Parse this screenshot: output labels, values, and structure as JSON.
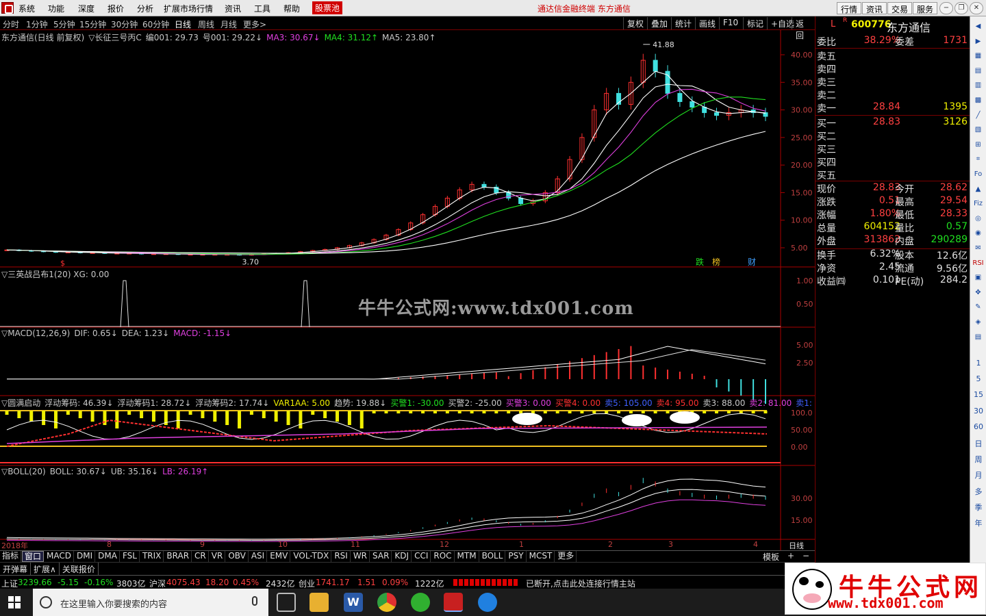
{
  "menu": {
    "items": [
      "系统",
      "功能",
      "深度",
      "报价",
      "分析",
      "扩展市场行情",
      "资讯",
      "工具",
      "帮助"
    ],
    "pool": "股票池",
    "center_title": "通达信金融终端  东方通信",
    "right_buttons": [
      "行情",
      "资讯",
      "交易",
      "服务"
    ]
  },
  "periods": [
    "分时",
    "1分钟",
    "5分钟",
    "15分钟",
    "30分钟",
    "60分钟",
    "日线",
    "周线",
    "月线",
    "更多>"
  ],
  "active_period": "日线",
  "toolbar": [
    "复权",
    "叠加",
    "统计",
    "画线",
    "F10",
    "标记",
    "+自选",
    "返回"
  ],
  "main_panel": {
    "title": "东方通信(日线 前复权)",
    "indicator": "▽长征三号丙C",
    "items": [
      {
        "text": "编001: 29.73",
        "color": "#c8c8c8"
      },
      {
        "text": "号001: 29.22↓",
        "color": "#c8c8c8"
      },
      {
        "text": "MA3: 30.67↓",
        "color": "#e040e0"
      },
      {
        "text": "MA4: 31.12↑",
        "color": "#20e020"
      },
      {
        "text": "MA5: 23.80↑",
        "color": "#c8c8c8"
      }
    ],
    "high_label": "41.88",
    "low_label": "3.70",
    "markers": [
      "跌",
      "榜",
      "财"
    ]
  },
  "panel2": {
    "title": "▽三英战吕布1(20)  XG: 0.00",
    "axis": [
      "1.00",
      "0.50"
    ]
  },
  "watermark_text": "牛牛公式网:www.tdx001.com",
  "macd_panel": {
    "items": [
      {
        "text": "▽MACD(12,26,9)",
        "color": "#c8c8c8"
      },
      {
        "text": "DIF: 0.65↓",
        "color": "#c8c8c8"
      },
      {
        "text": "DEA: 1.23↓",
        "color": "#c8c8c8"
      },
      {
        "text": "MACD: -1.15↓",
        "color": "#e040e0"
      }
    ],
    "axis": [
      "5.00",
      "2.50"
    ]
  },
  "yuanman_panel": {
    "items": [
      {
        "text": "▽圆满启动",
        "color": "#c8c8c8"
      },
      {
        "text": "浮动筹码: 46.39↓",
        "color": "#c8c8c8"
      },
      {
        "text": "浮动筹码1: 28.72↓",
        "color": "#c8c8c8"
      },
      {
        "text": "浮动筹码2: 17.74↓",
        "color": "#c8c8c8"
      },
      {
        "text": "VAR1AA: 5.00",
        "color": "#f0f000"
      },
      {
        "text": "趋势: 19.88↓",
        "color": "#c8c8c8"
      },
      {
        "text": "买警1: -30.00",
        "color": "#20e020"
      },
      {
        "text": "买警2: -25.00",
        "color": "#c8c8c8"
      },
      {
        "text": "买警3: 0.00",
        "color": "#e040e0"
      },
      {
        "text": "买警4: 0.00",
        "color": "#ff3030"
      },
      {
        "text": "卖5: 105.00",
        "color": "#4060ff"
      },
      {
        "text": "卖4: 95.00",
        "color": "#ff3030"
      },
      {
        "text": "卖3: 88.00",
        "color": "#c8c8c8"
      },
      {
        "text": "卖2: 81.00",
        "color": "#e040e0"
      },
      {
        "text": "卖1: 74.00",
        "color": "#4060ff"
      }
    ],
    "axis": [
      "100.0",
      "50.00",
      "0.00"
    ]
  },
  "boll_panel": {
    "items": [
      {
        "text": "▽BOLL(20)",
        "color": "#c8c8c8"
      },
      {
        "text": "BOLL: 30.67↓",
        "color": "#c8c8c8"
      },
      {
        "text": "UB: 35.16↓",
        "color": "#c8c8c8"
      },
      {
        "text": "LB: 26.19↑",
        "color": "#e040e0"
      }
    ],
    "axis": [
      "30.00",
      "15.00"
    ]
  },
  "date_axis": [
    "2018年",
    "8",
    "9",
    "10",
    "11",
    "12",
    "1",
    "2",
    "3",
    "4"
  ],
  "date_axis_right": "日线",
  "indicator_tabs": [
    "指标",
    "窗口",
    "MACD",
    "DMI",
    "DMA",
    "FSL",
    "TRIX",
    "BRAR",
    "CR",
    "VR",
    "OBV",
    "ASI",
    "EMV",
    "VOL-TDX",
    "RSI",
    "WR",
    "SAR",
    "KDJ",
    "CCI",
    "ROC",
    "MTM",
    "BOLL",
    "PSY",
    "MCST",
    "更多"
  ],
  "selected_tab": "窗口",
  "template_label": "模板",
  "sub_tabs": [
    "开弹幕",
    "扩展∧",
    "关联报价"
  ],
  "status": {
    "sh_label": "上证",
    "sh_val": "3239.66",
    "sh_chg": "-5.15",
    "sh_pct": "-0.16%",
    "sh_amt": "3803亿",
    "sz_label": "沪深",
    "sz_val": "4075.43",
    "sz_chg": "18.20",
    "sz_pct": "0.45%",
    "sz_amt": "2432亿",
    "cy_label": "创业",
    "cy_val": "1741.17",
    "cy_chg": "1.51",
    "cy_pct": "0.09%",
    "cy_amt": "1222亿",
    "conn": "已断开,点击此处连接行情主站"
  },
  "quote": {
    "code": "600776",
    "name": "东方通信",
    "L": "L",
    "R": "R",
    "weibi_label": "委比",
    "weibi": "38.29%",
    "weicha_label": "委差",
    "weicha": "1731",
    "sells": [
      {
        "label": "卖五",
        "price": "",
        "vol": ""
      },
      {
        "label": "卖四",
        "price": "",
        "vol": ""
      },
      {
        "label": "卖三",
        "price": "",
        "vol": ""
      },
      {
        "label": "卖二",
        "price": "",
        "vol": ""
      },
      {
        "label": "卖一",
        "price": "28.84",
        "vol": "1395"
      }
    ],
    "buys": [
      {
        "label": "买一",
        "price": "28.83",
        "vol": "3126"
      },
      {
        "label": "买二",
        "price": "",
        "vol": ""
      },
      {
        "label": "买三",
        "price": "",
        "vol": ""
      },
      {
        "label": "买四",
        "price": "",
        "vol": ""
      },
      {
        "label": "买五",
        "price": "",
        "vol": ""
      }
    ],
    "stats": [
      {
        "l1": "现价",
        "v1": "28.83",
        "c1": "#ff4040",
        "l2": "今开",
        "v2": "28.62",
        "c2": "#ff4040"
      },
      {
        "l1": "涨跌",
        "v1": "0.51",
        "c1": "#ff4040",
        "l2": "最高",
        "v2": "29.54",
        "c2": "#ff4040"
      },
      {
        "l1": "涨幅",
        "v1": "1.80%",
        "c1": "#ff4040",
        "l2": "最低",
        "v2": "28.33",
        "c2": "#ff4040"
      },
      {
        "l1": "总量",
        "v1": "604152",
        "c1": "#f0f000",
        "l2": "量比",
        "v2": "0.57",
        "c2": "#20e020"
      },
      {
        "l1": "外盘",
        "v1": "313862",
        "c1": "#ff4040",
        "l2": "内盘",
        "v2": "290289",
        "c2": "#20e020"
      },
      {
        "l1": "换手",
        "v1": "6.32%",
        "c1": "#e0e0e0",
        "l2": "股本",
        "v2": "12.6亿",
        "c2": "#e0e0e0"
      },
      {
        "l1": "净资",
        "v1": "2.45",
        "c1": "#e0e0e0",
        "l2": "流通",
        "v2": "9.56亿",
        "c2": "#e0e0e0"
      },
      {
        "l1": "收益㈣",
        "v1": "0.101",
        "c1": "#e0e0e0",
        "l2": "PE(动)",
        "v2": "284.2",
        "c2": "#e0e0e0"
      }
    ]
  },
  "icon_col_numbers": [
    "1",
    "5",
    "15",
    "30",
    "60",
    "日",
    "周",
    "月",
    "多",
    "季",
    "年"
  ],
  "taskbar": {
    "search_placeholder": "在这里输入你要搜索的内容"
  },
  "watermark_logo": {
    "cn": "牛牛公式网",
    "url": "www.tdx001.com"
  },
  "colors": {
    "up": "#ff3030",
    "down": "#40e0e0",
    "ma1": "#ffffff",
    "ma3": "#e040e0",
    "ma4": "#20e020",
    "axis_red": "#aa0000"
  },
  "chart_data": {
    "type": "candlestick",
    "price_axis": [
      40,
      35,
      30,
      25,
      20,
      15,
      10,
      5
    ],
    "high": 41.88,
    "low": 3.7,
    "close_series": [
      4.6,
      4.5,
      4.4,
      4.3,
      4.2,
      4.2,
      4.1,
      4.1,
      4.0,
      4.0,
      4.0,
      3.9,
      3.9,
      3.9,
      3.8,
      3.8,
      3.8,
      3.8,
      3.8,
      3.7,
      3.8,
      3.9,
      4.0,
      4.1,
      4.3,
      4.5,
      4.7,
      5.0,
      5.4,
      5.9,
      6.5,
      7.3,
      8.3,
      9.5,
      11.0,
      12.5,
      14.0,
      15.5,
      16.5,
      16.0,
      15.0,
      14.0,
      13.0,
      13.5,
      15.0,
      17.5,
      21.0,
      25.0,
      30.0,
      33.0,
      31.0,
      35.0,
      39.0,
      37.0,
      33.0,
      31.5,
      30.5,
      29.5,
      29.0,
      29.5,
      30.0,
      29.5,
      28.83
    ]
  }
}
